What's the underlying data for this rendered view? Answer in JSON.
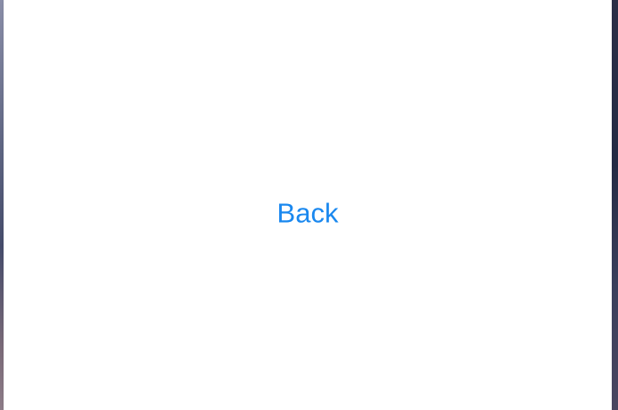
{
  "screen": {
    "back_button_label": "Back",
    "accent_color": "#1a88ef",
    "window_background": "#ffffff"
  }
}
